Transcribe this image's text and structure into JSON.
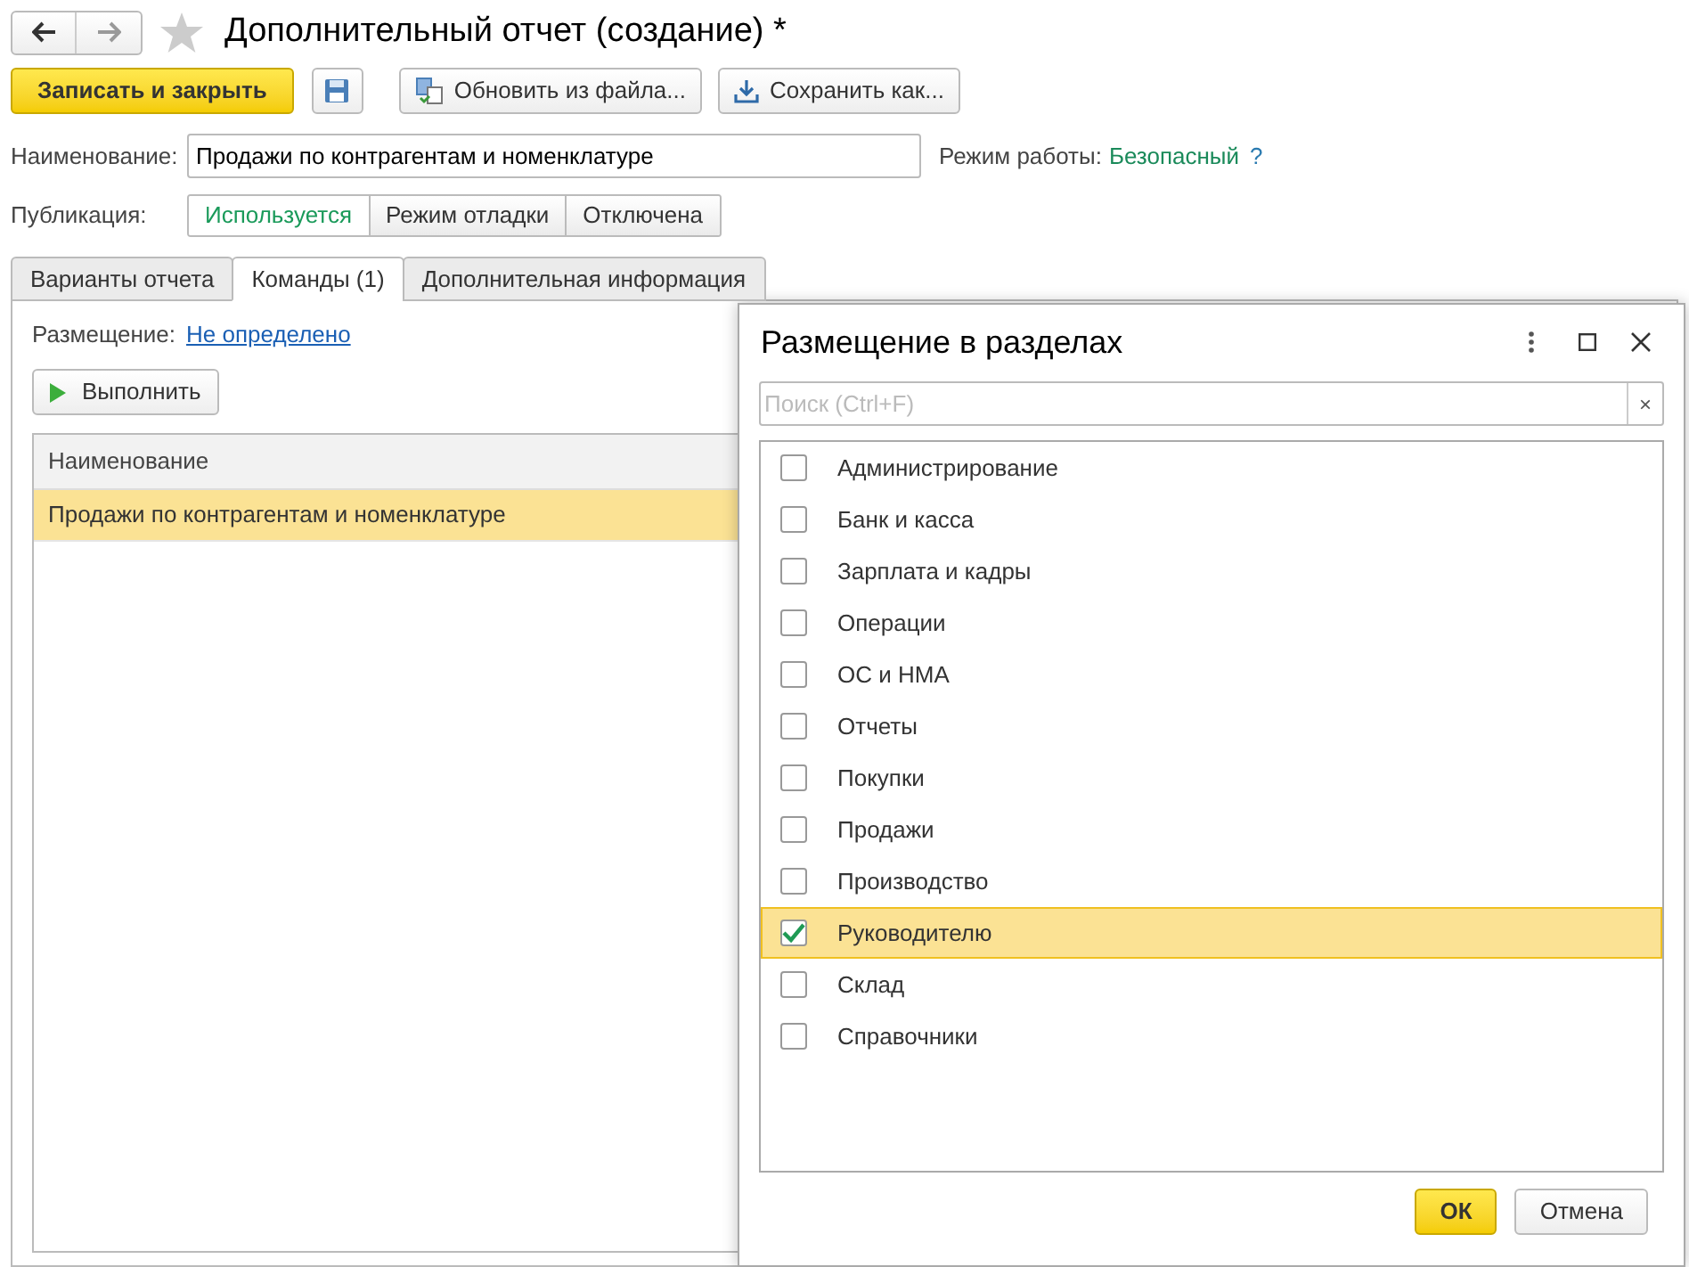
{
  "window": {
    "title": "Дополнительный отчет (создание) *"
  },
  "toolbar": {
    "buttons": [
      {
        "kind": "primary",
        "label": "Записать и закрыть"
      },
      {
        "kind": "save"
      },
      {
        "kind": "reload",
        "label": "Обновить из файла..."
      },
      {
        "kind": "download",
        "label": "Сохранить как..."
      }
    ]
  },
  "name_field": {
    "label": "Наименование:",
    "value": "Продажи по контрагентам и номенклатуре"
  },
  "mode": {
    "label": "Режим работы:",
    "value": "Безопасный",
    "help": "?"
  },
  "publication": {
    "label": "Публикация:",
    "options": [
      {
        "label": "Используется",
        "selected": true
      },
      {
        "label": "Режим отладки",
        "selected": false
      },
      {
        "label": "Отключена",
        "selected": false
      }
    ]
  },
  "tabs": [
    {
      "label": "Варианты отчета",
      "selected": false
    },
    {
      "label": "Команды (1)",
      "selected": true
    },
    {
      "label": "Дополнительная информация",
      "selected": false
    }
  ],
  "commands": {
    "placement_label": "Размещение:",
    "placement_link": "Не определено",
    "execute_button": "Выполнить",
    "table": {
      "columns": [
        "Наименование"
      ],
      "rows": [
        {
          "cells": [
            "Продажи по контрагентам и номенклатуре"
          ],
          "selected": true
        }
      ]
    }
  },
  "dialog": {
    "title": "Размещение в разделах",
    "search": {
      "placeholder": "Поиск (Ctrl+F)",
      "clear": "×"
    },
    "items": [
      {
        "label": "Администрирование",
        "checked": false,
        "selected": false
      },
      {
        "label": "Банк и касса",
        "checked": false,
        "selected": false
      },
      {
        "label": "Зарплата и кадры",
        "checked": false,
        "selected": false
      },
      {
        "label": "Операции",
        "checked": false,
        "selected": false
      },
      {
        "label": "ОС и НМА",
        "checked": false,
        "selected": false
      },
      {
        "label": "Отчеты",
        "checked": false,
        "selected": false
      },
      {
        "label": "Покупки",
        "checked": false,
        "selected": false
      },
      {
        "label": "Продажи",
        "checked": false,
        "selected": false
      },
      {
        "label": "Производство",
        "checked": false,
        "selected": false
      },
      {
        "label": "Руководителю",
        "checked": true,
        "selected": true
      },
      {
        "label": "Склад",
        "checked": false,
        "selected": false
      },
      {
        "label": "Справочники",
        "checked": false,
        "selected": false
      }
    ],
    "buttons": [
      {
        "kind": "primary",
        "label": "ОК"
      },
      {
        "kind": "normal",
        "label": "Отмена"
      }
    ]
  }
}
